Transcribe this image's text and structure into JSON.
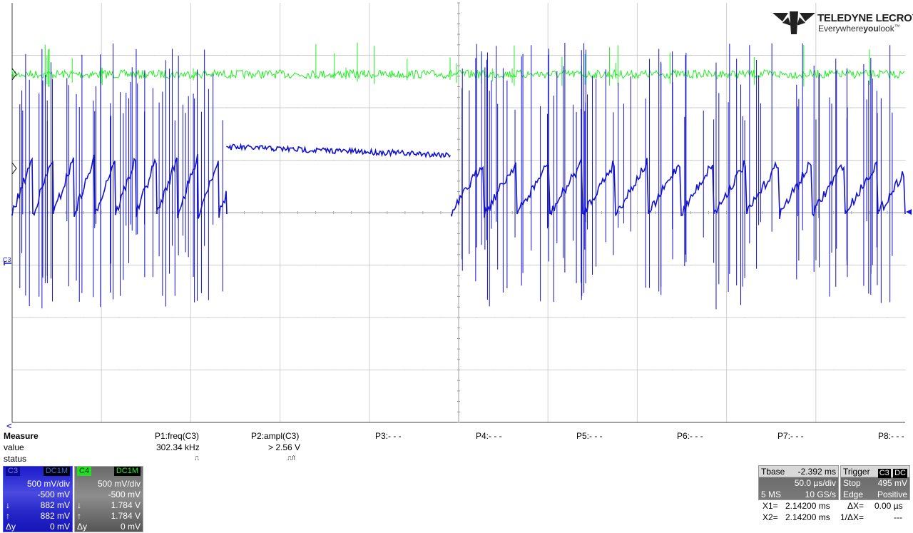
{
  "brand": {
    "name": "TELEDYNE LECROY",
    "tagline_a": "Everywhere",
    "tagline_b": "you",
    "tagline_c": "look",
    "tm": "™"
  },
  "traces": [
    {
      "id": "C4",
      "color": "#22ee22"
    },
    {
      "id": "C3",
      "color": "#1212cc"
    }
  ],
  "ch_marker": "C3",
  "measure": {
    "header": "Measure",
    "row_labels": [
      "value",
      "status"
    ],
    "params": [
      {
        "name": "P1:freq(C3)",
        "value": "302.34 kHz",
        "status": "⎍"
      },
      {
        "name": "P2:ampl(C3)",
        "value": "> 2.56 V",
        "status": "⎍⇑"
      },
      {
        "name": "P3:- - -",
        "value": "",
        "status": ""
      },
      {
        "name": "P4:- - -",
        "value": "",
        "status": ""
      },
      {
        "name": "P5:- - -",
        "value": "",
        "status": ""
      },
      {
        "name": "P6:- - -",
        "value": "",
        "status": ""
      },
      {
        "name": "P7:- - -",
        "value": "",
        "status": ""
      },
      {
        "name": "P8:- - -",
        "value": "",
        "status": ""
      }
    ]
  },
  "channels": [
    {
      "name": "C3",
      "coupling": "DC1M",
      "vdiv": "500 mV/div",
      "offset": "-500 mV",
      "c1_sym": "↓",
      "c1": "882 mV",
      "c2_sym": "↑",
      "c2": "882 mV",
      "dy_sym": "Δy",
      "dy": "0 mV",
      "color": "#1a1ad8"
    },
    {
      "name": "C4",
      "coupling": "DC1M",
      "vdiv": "500 mV/div",
      "offset": "-500 mV",
      "c1_sym": "↓",
      "c1": "1.784 V",
      "c2_sym": "↑",
      "c2": "1.784 V",
      "dy_sym": "Δy",
      "dy": "0 mV",
      "color": "#22ee22"
    }
  ],
  "timebase": {
    "label": "Tbase",
    "delay": "-2.392 ms",
    "tdiv": "50.0 µs/div",
    "samples": "5 MS",
    "rate": "10 GS/s"
  },
  "trigger": {
    "label": "Trigger",
    "source": "C3",
    "coupling": "DC",
    "mode": "Stop",
    "level": "495 mV",
    "type": "Edge",
    "slope": "Positive"
  },
  "cursors": {
    "x1_label": "X1=",
    "x1": "2.14200 ms",
    "x2_label": "X2=",
    "x2": "2.14200 ms",
    "dx_label": "ΔX=",
    "dx": "0.00 µs",
    "inv_label": "1/ΔX=",
    "inv": "---"
  }
}
